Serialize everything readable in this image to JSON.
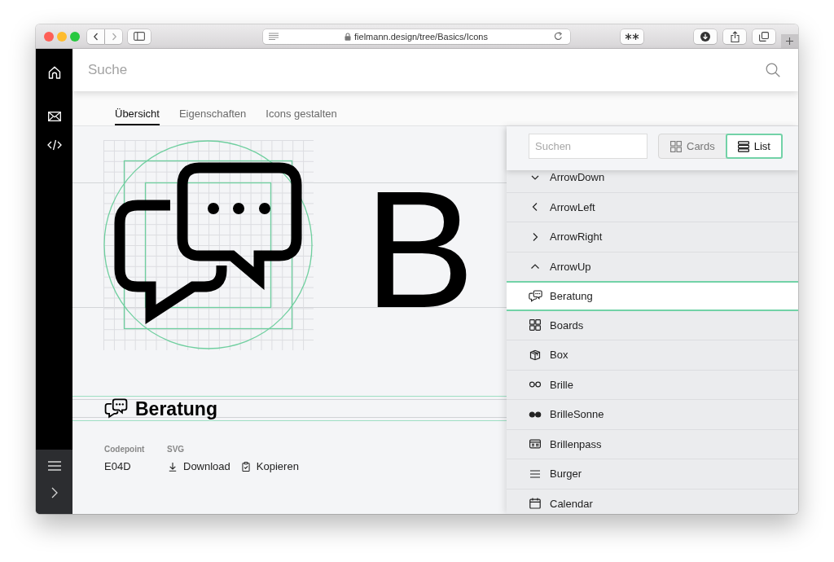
{
  "browser": {
    "url": "fielmann.design/tree/Basics/Icons"
  },
  "search": {
    "placeholder": "Suche"
  },
  "tabs": [
    {
      "label": "Übersicht",
      "selected": true
    },
    {
      "label": "Eigenschaften",
      "selected": false
    },
    {
      "label": "Icons gestalten",
      "selected": false
    }
  ],
  "preview": {
    "specimen": "B"
  },
  "icon_detail": {
    "title": "Beratung",
    "codepoint_label": "Codepoint",
    "codepoint": "E04D",
    "svg_label": "SVG",
    "actions": [
      "Download",
      "Kopieren"
    ]
  },
  "icon_list": {
    "search_placeholder": "Suchen",
    "views": [
      {
        "label": "Cards",
        "selected": false
      },
      {
        "label": "List",
        "selected": true
      }
    ],
    "items": [
      {
        "name": "ArrowDown",
        "selected": false
      },
      {
        "name": "ArrowLeft",
        "selected": false
      },
      {
        "name": "ArrowRight",
        "selected": false
      },
      {
        "name": "ArrowUp",
        "selected": false
      },
      {
        "name": "Beratung",
        "selected": true
      },
      {
        "name": "Boards",
        "selected": false
      },
      {
        "name": "Box",
        "selected": false
      },
      {
        "name": "Brille",
        "selected": false
      },
      {
        "name": "BrilleSonne",
        "selected": false
      },
      {
        "name": "Brillenpass",
        "selected": false
      },
      {
        "name": "Burger",
        "selected": false
      },
      {
        "name": "Calendar",
        "selected": false
      }
    ]
  }
}
